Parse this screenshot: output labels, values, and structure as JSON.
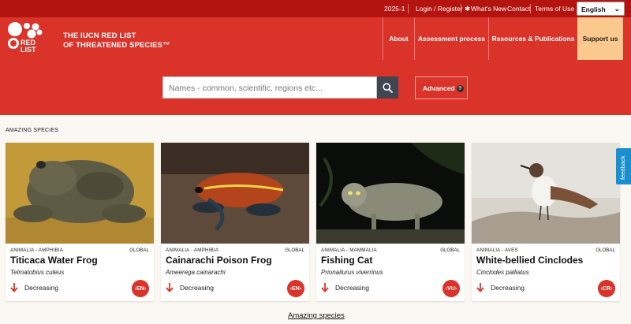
{
  "topbar": {
    "version": "2025-1",
    "login": "Login / Register",
    "whats_new": "What's New",
    "contact": "Contact",
    "terms": "Terms of Use",
    "language": "English"
  },
  "header": {
    "logo_text": "RED LIST",
    "title_line1": "THE IUCN RED LIST",
    "title_line2": "OF THREATENED SPECIES™",
    "nav": [
      "About",
      "Assessment process",
      "Resources & Publications",
      "Support us"
    ]
  },
  "search": {
    "placeholder": "Names - common, scientific, regions etc...",
    "advanced_label": "Advanced",
    "advanced_help": "?"
  },
  "section_title": "AMAZING SPECIES",
  "cards": [
    {
      "taxonomy": "ANIMALIA - AMPHIBIA",
      "scope": "GLOBAL",
      "name": "Titicaca Water Frog",
      "scientific": "Telmatobius culeus",
      "trend": "Decreasing",
      "status": "EN"
    },
    {
      "taxonomy": "ANIMALIA - AMPHIBIA",
      "scope": "GLOBAL",
      "name": "Cainarachi Poison Frog",
      "scientific": "Ameerega cainarachi",
      "trend": "Decreasing",
      "status": "EN"
    },
    {
      "taxonomy": "ANIMALIA - MAMMALIA",
      "scope": "GLOBAL",
      "name": "Fishing Cat",
      "scientific": "Prionailurus viverrinus",
      "trend": "Decreasing",
      "status": "VU"
    },
    {
      "taxonomy": "ANIMALIA - AVES",
      "scope": "GLOBAL",
      "name": "White-bellied Cinclodes",
      "scientific": "Cinclodes palliatus",
      "trend": "Decreasing",
      "status": "CR"
    }
  ],
  "feedback_label": "feedback",
  "more_link": "Amazing species",
  "colors": {
    "brand_red": "#d9332a",
    "topbar_red": "#b4140f",
    "support_bg": "#fbc98e",
    "feedback_blue": "#1a8fce"
  }
}
